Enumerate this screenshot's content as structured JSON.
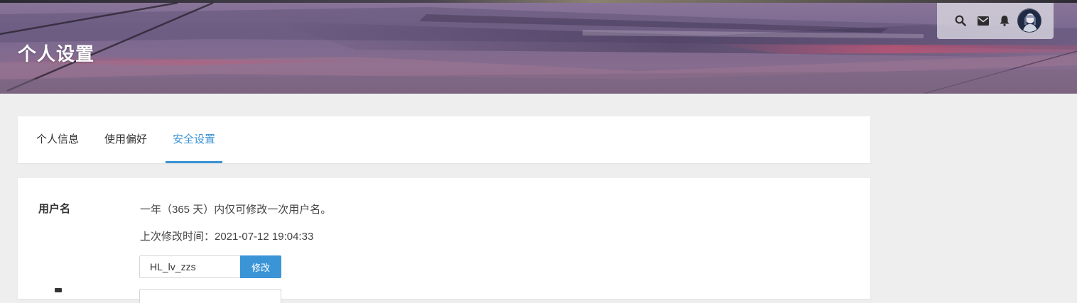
{
  "header": {
    "title": "个人设置"
  },
  "toolbar": {
    "icons": [
      "search-icon",
      "mail-icon",
      "bell-icon"
    ],
    "avatar": "user-avatar"
  },
  "tabs": [
    {
      "label": "个人信息",
      "active": false
    },
    {
      "label": "使用偏好",
      "active": false
    },
    {
      "label": "安全设置",
      "active": true
    }
  ],
  "security": {
    "username_section": {
      "label": "用户名",
      "rule_text": "一年（365 天）内仅可修改一次用户名。",
      "last_modified_text": "上次修改时间：2021-07-12 19:04:33",
      "input_value": "HL_lv_zzs",
      "button_label": "修改"
    }
  },
  "colors": {
    "accent": "#3a94d6",
    "page_background": "#eeeeee",
    "card_background": "#ffffff"
  }
}
